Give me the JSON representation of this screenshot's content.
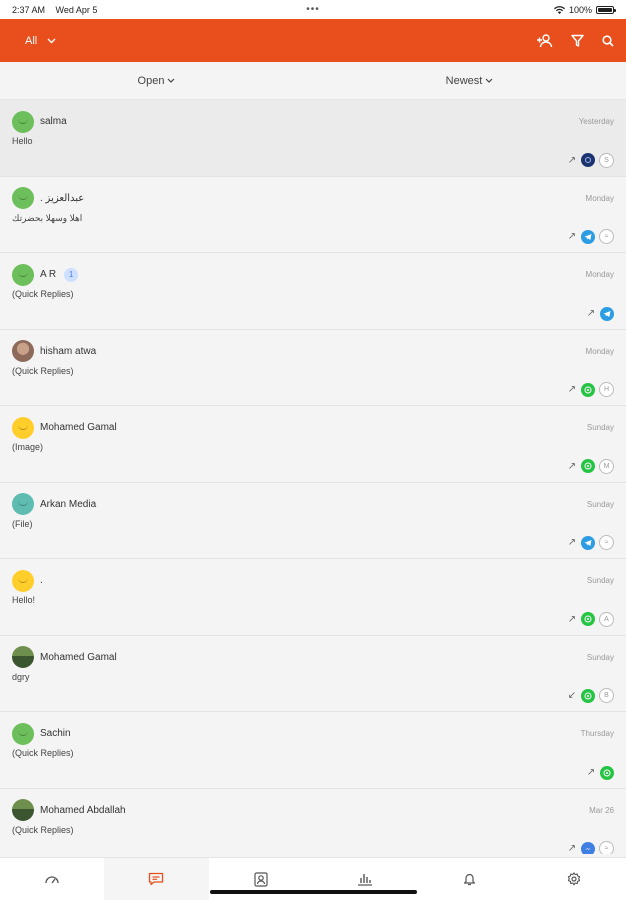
{
  "status": {
    "time": "2:37 AM",
    "date": "Wed Apr 5",
    "battery": "100%"
  },
  "header": {
    "filter_label": "All"
  },
  "subbar": {
    "status_filter": "Open",
    "sort": "Newest"
  },
  "colors": {
    "brand": "#e84f1c",
    "whatsapp": "#25c443",
    "telegram": "#2c9ce3"
  },
  "conversations": [
    {
      "name": "salma",
      "time": "Yesterday",
      "preview": "Hello",
      "channel": "dark-app-icon",
      "direction": "↗",
      "agent": "S"
    },
    {
      "name": "عبدالعزيز .",
      "time": "Monday",
      "preview": "اهلا وسهلا بحضرتك",
      "channel": "telegram-icon",
      "direction": "↗",
      "agent": ""
    },
    {
      "name": "A R",
      "unread": "1",
      "time": "Monday",
      "preview": "(Quick Replies)",
      "channel": "telegram-icon",
      "direction": "↗",
      "agent": ""
    },
    {
      "name": "hisham atwa",
      "time": "Monday",
      "preview": "(Quick Replies)",
      "channel": "whatsapp-icon",
      "direction": "↗",
      "agent": "H"
    },
    {
      "name": "Mohamed Gamal",
      "time": "Sunday",
      "preview": "(Image)",
      "channel": "whatsapp-icon",
      "direction": "↗",
      "agent": "M"
    },
    {
      "name": "Arkan Media",
      "time": "Sunday",
      "preview": "(File)",
      "channel": "telegram-icon",
      "direction": "↗",
      "agent": ""
    },
    {
      "name": ".",
      "time": "Sunday",
      "preview": "Hello!",
      "channel": "whatsapp-icon",
      "direction": "↗",
      "agent": "A"
    },
    {
      "name": "Mohamed Gamal",
      "time": "Sunday",
      "preview": "dgry",
      "channel": "whatsapp-icon",
      "direction": "↙",
      "agent": "B"
    },
    {
      "name": "Sachin",
      "time": "Thursday",
      "preview": "(Quick Replies)",
      "channel": "whatsapp-icon",
      "direction": "↗",
      "agent": ""
    },
    {
      "name": "Mohamed Abdallah",
      "time": "Mar 26",
      "preview": "(Quick Replies)",
      "channel": "messenger-icon",
      "direction": "↗",
      "agent": ""
    }
  ],
  "tabs": [
    {
      "icon": "dashboard-icon"
    },
    {
      "icon": "chat-icon",
      "active": true
    },
    {
      "icon": "contacts-icon"
    },
    {
      "icon": "reports-icon"
    },
    {
      "icon": "notifications-icon"
    },
    {
      "icon": "settings-icon"
    }
  ]
}
